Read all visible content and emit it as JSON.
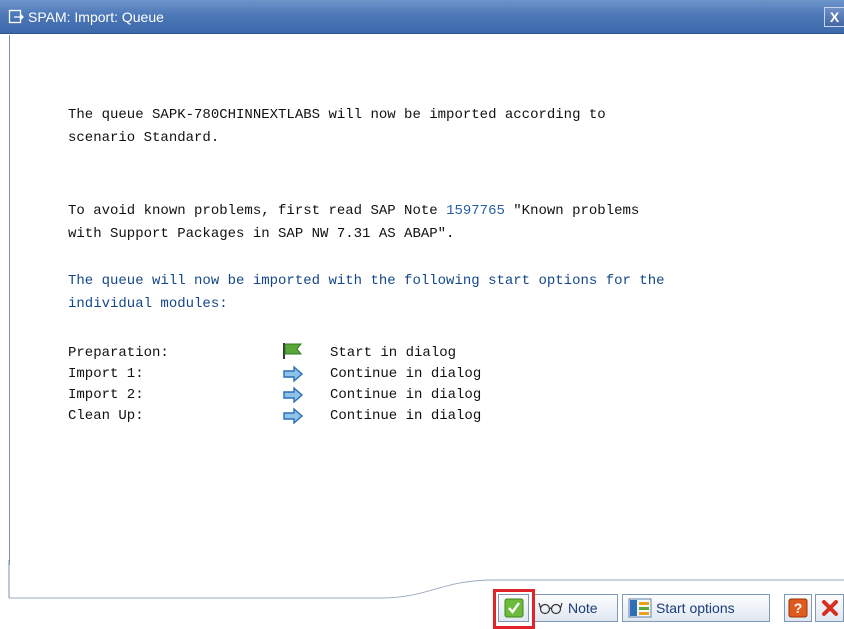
{
  "window": {
    "title": "SPAM: Import: Queue",
    "close_glyph": "X"
  },
  "message": {
    "line1": "The queue SAPK-780CHINNEXTLABS will now be imported according to",
    "line2": "scenario Standard.",
    "note_prefix": "To avoid known problems, first read SAP Note ",
    "note_number": "1597765",
    "note_suffix": " \"Known problems",
    "note_line2": "with Support Packages in SAP NW 7.31 AS ABAP\".",
    "options_intro1": "The queue will now be imported with the following start options for the",
    "options_intro2": "individual modules:"
  },
  "start_options": [
    {
      "label": "Preparation:",
      "icon": "green-flag-icon",
      "value": "Start in dialog"
    },
    {
      "label": "Import 1:",
      "icon": "blue-arrow-right-icon",
      "value": "Continue in dialog"
    },
    {
      "label": "Import 2:",
      "icon": "blue-arrow-right-icon",
      "value": "Continue in dialog"
    },
    {
      "label": "Clean Up:",
      "icon": "blue-arrow-right-icon",
      "value": "Continue in dialog"
    }
  ],
  "toolbar": {
    "confirm_icon": "green-check-icon",
    "note_label": "Note",
    "start_options_label": "Start options",
    "help_icon": "help-icon",
    "cancel_icon": "cancel-icon"
  },
  "colors": {
    "title_bar": "#4d78b7",
    "info_text": "#14478a",
    "highlight": "#e0242a"
  }
}
